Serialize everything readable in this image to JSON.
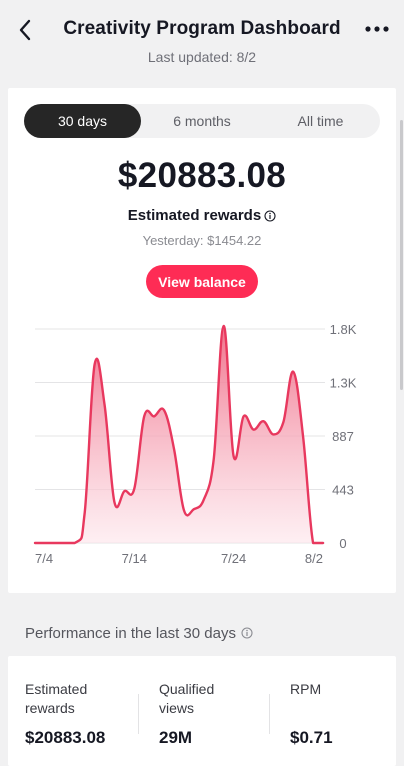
{
  "header": {
    "title": "Creativity Program Dashboard",
    "last_updated": "Last updated: 8/2"
  },
  "tabs": [
    {
      "label": "30 days",
      "active": true
    },
    {
      "label": "6 months",
      "active": false
    },
    {
      "label": "All time",
      "active": false
    }
  ],
  "summary": {
    "amount": "$20883.08",
    "label": "Estimated rewards",
    "yesterday": "Yesterday: $1454.22",
    "button": "View balance"
  },
  "chart_data": {
    "type": "area",
    "x_tick_labels": [
      "7/4",
      "7/14",
      "7/24",
      "8/2"
    ],
    "y_tick_labels": [
      "1.8K",
      "1.3K",
      "887",
      "443",
      "0"
    ],
    "y_ticks": [
      1774,
      1330,
      887,
      443,
      0
    ],
    "ylim": [
      0,
      1774
    ],
    "x": [
      0,
      4,
      5,
      6,
      7,
      8,
      9,
      10,
      11,
      12,
      13,
      14,
      15,
      16,
      17,
      18,
      19,
      20,
      21,
      22,
      23,
      24,
      25,
      26,
      27,
      28,
      29
    ],
    "values": [
      0,
      0,
      250,
      1480,
      1150,
      340,
      430,
      450,
      1050,
      1050,
      1100,
      780,
      270,
      280,
      360,
      700,
      1800,
      720,
      1050,
      940,
      1010,
      900,
      1000,
      1420,
      880,
      0,
      0
    ],
    "grid": true,
    "color": "#e8385e",
    "fill_top": "#ef6b86",
    "fill_bottom": "#fde4ea"
  },
  "performance": {
    "title": "Performance in the last 30 days",
    "stats": [
      {
        "label_line1": "Estimated",
        "label_line2": "rewards",
        "value": "$20883.08"
      },
      {
        "label_line1": "Qualified",
        "label_line2": "views",
        "value": "29M"
      },
      {
        "label_line1": "RPM",
        "label_line2": "",
        "value": "$0.71"
      }
    ]
  },
  "colors": {
    "accent": "#fe2c55",
    "dark_tab": "#262626"
  }
}
